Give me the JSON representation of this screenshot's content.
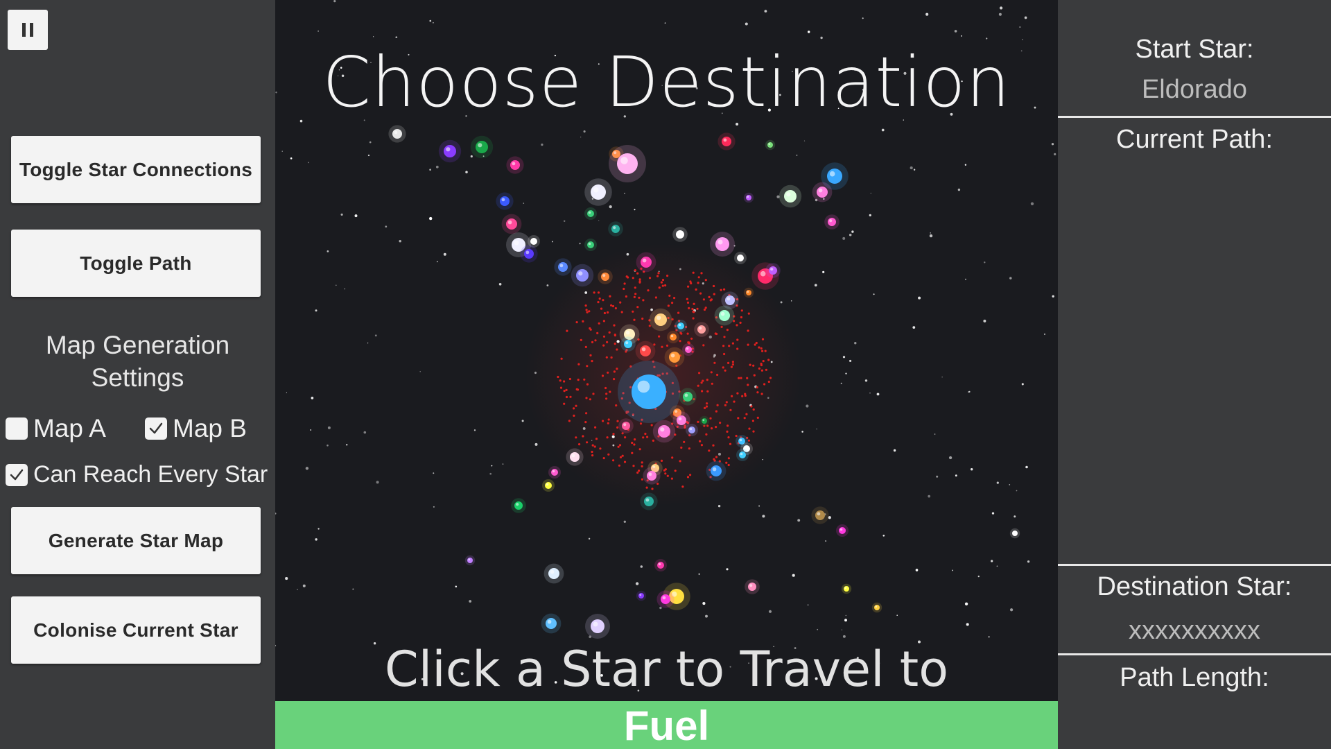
{
  "left_panel": {
    "pause_icon": "pause-icon",
    "toggle_connections_label": "Toggle Star Connections",
    "toggle_path_label": "Toggle Path",
    "settings_title_line1": "Map Generation",
    "settings_title_line2": "Settings",
    "map_a": {
      "label": "Map A",
      "checked": false
    },
    "map_b": {
      "label": "Map B",
      "checked": true
    },
    "can_reach": {
      "label": "Can Reach Every Star",
      "checked": true
    },
    "generate_label": "Generate Star Map",
    "colonise_label": "Colonise Current Star"
  },
  "main": {
    "title": "Choose Destination",
    "hint": "Click a Star to Travel to",
    "fuel_label": "Fuel",
    "fuel_level": 1.0,
    "fuel_color": "#69d27b",
    "background_color": "#1a1b1f"
  },
  "right_panel": {
    "start_star_label": "Start Star:",
    "start_star_value": "Eldorado",
    "current_path_label": "Current Path:",
    "destination_label": "Destination Star:",
    "destination_value": "xxxxxxxxxx",
    "path_length_label": "Path Length:"
  }
}
